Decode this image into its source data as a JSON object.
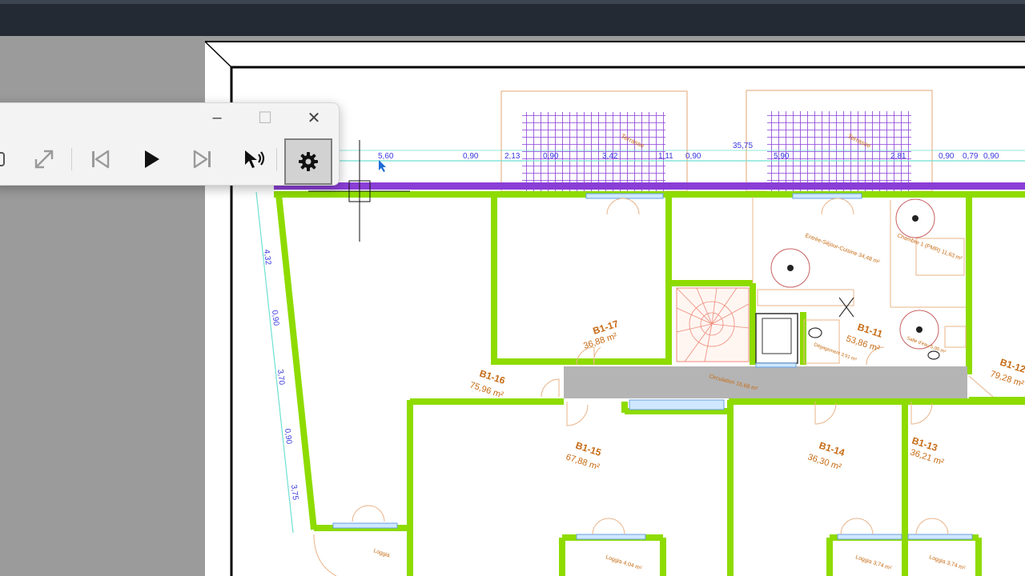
{
  "window": {
    "minimize_symbol": "–",
    "maximize_symbol": "☐",
    "close_symbol": "✕"
  },
  "toolbar": {
    "icons": [
      "expand-icon",
      "skip-previous-icon",
      "play-icon",
      "skip-next-icon",
      "speaker-cursor-icon",
      "gear-icon"
    ]
  },
  "plan": {
    "rooms": [
      {
        "id": "B1-17",
        "area": "36,88 m²"
      },
      {
        "id": "B1-16",
        "area": "75,96 m²"
      },
      {
        "id": "B1-15",
        "area": "67,88 m²"
      },
      {
        "id": "B1-14",
        "area": "36,30 m²"
      },
      {
        "id": "B1-13",
        "area": "36,21 m²"
      },
      {
        "id": "B1-11",
        "area": "53,86 m²"
      },
      {
        "id": "B1-12",
        "area": "79,28 m²"
      }
    ],
    "top_dimensions": [
      "5,60",
      "0,90",
      "2,13",
      "0,90",
      "3,42",
      "1,11",
      "0,90",
      "35,75",
      "5,90",
      "2,81",
      "0,90",
      "0,79",
      "0,90"
    ],
    "left_dimensions": [
      "4,32",
      "0,90",
      "3,70",
      "0,90",
      "3,75"
    ],
    "minor_labels": [
      "Entrée-Séjour-Cuisine 34,48 m²",
      "Chambre 1 (PMR) 11,63 m²",
      "Circulation 16,68 m²",
      "Loggia",
      "Loggia 4,04 m²",
      "Loggia 3,74 m²",
      "Loggia 3,74 m²",
      "Loggia 3,74 m²",
      "Dégagement 3,91 m²",
      "Salle d'eau 5,00 m²",
      "Terrasse"
    ]
  },
  "colors": {
    "wall_green": "#8edb00",
    "facade_purple": "#8a3ed6",
    "dimension_cyan": "#6fe0d2",
    "dimension_text": "#3a3ae0",
    "room_label": "#c66a12",
    "circulation_gray": "#b4b4b4",
    "stair_salmon": "#ef8a78"
  }
}
